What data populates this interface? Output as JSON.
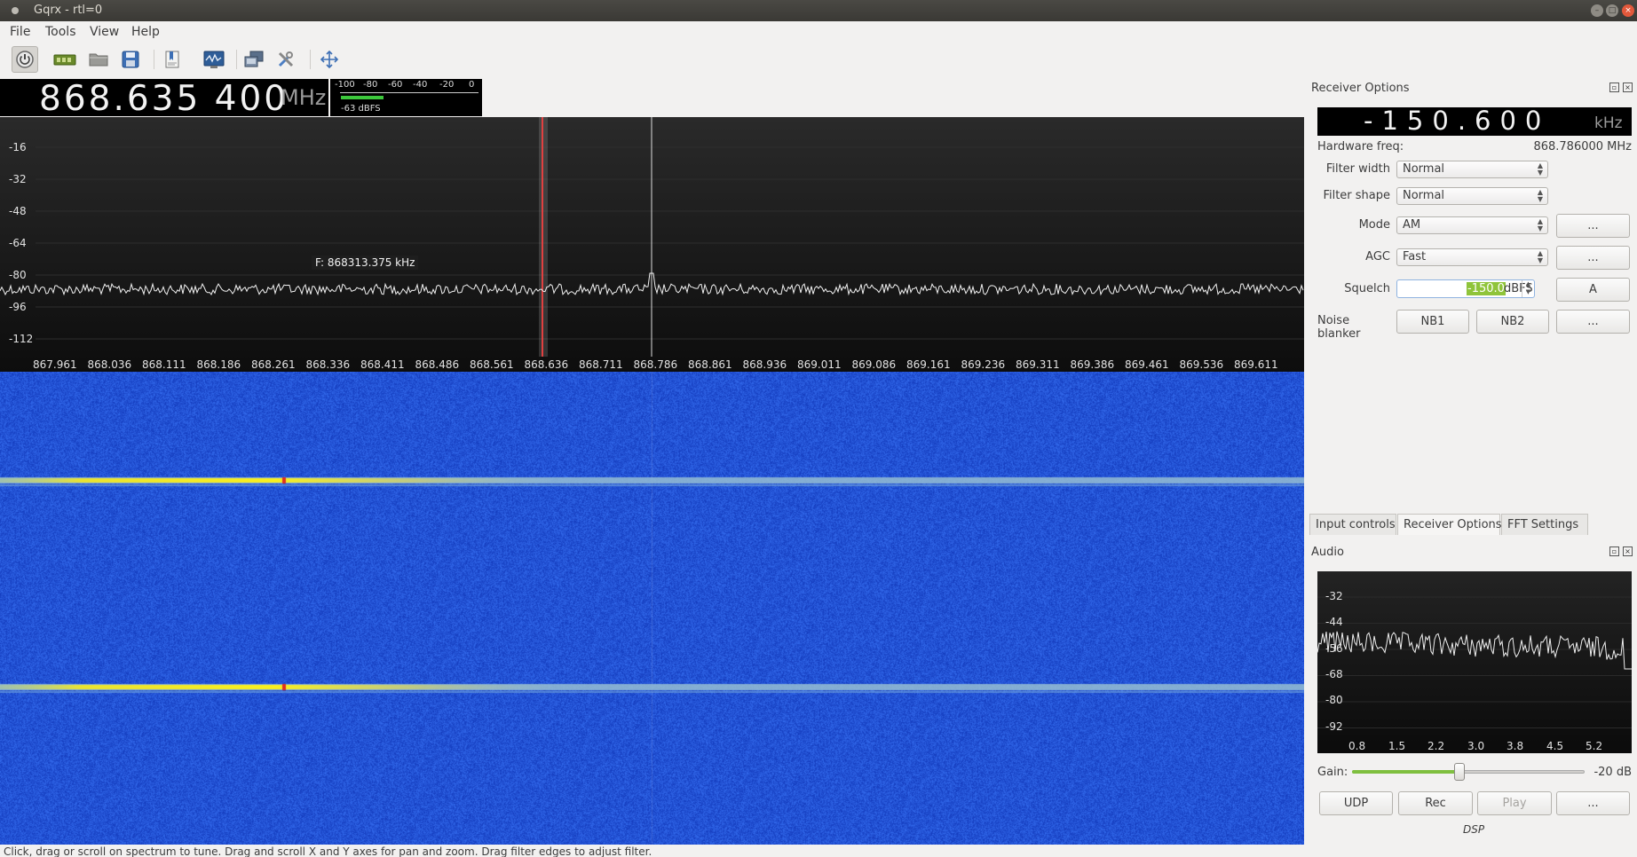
{
  "window": {
    "title": "Gqrx - rtl=0"
  },
  "menu": {
    "file": "File",
    "tools": "Tools",
    "view": "View",
    "help": "Help"
  },
  "toolbar": {
    "icons": [
      "power-icon",
      "device-icon",
      "open-folder-icon",
      "save-icon",
      "bookmark-icon",
      "waveform-icon",
      "remote-icon",
      "tools-icon",
      "fullscreen-icon"
    ]
  },
  "frequency": {
    "value": "868.635 400",
    "unit": "MHz"
  },
  "meter": {
    "ticks": [
      "-100",
      "-80",
      "-60",
      "-40",
      "-20",
      "0"
    ],
    "level_label": "-63 dBFS",
    "level_fraction": 0.31
  },
  "spectrum": {
    "y_ticks": [
      "-16",
      "-32",
      "-48",
      "-64",
      "-80",
      "-96",
      "-112"
    ],
    "x_ticks": [
      "867.961",
      "868.036",
      "868.111",
      "868.186",
      "868.261",
      "868.336",
      "868.411",
      "868.486",
      "868.561",
      "868.636",
      "868.711",
      "868.786",
      "868.861",
      "868.936",
      "869.011",
      "869.086",
      "869.161",
      "869.236",
      "869.311",
      "869.386",
      "869.461",
      "869.536",
      "869.611"
    ],
    "hover": "F: 868313.375 kHz"
  },
  "status": {
    "text": "Click, drag or scroll on spectrum to tune. Drag and scroll X and Y axes for pan and zoom. Drag filter edges to adjust filter."
  },
  "receiver": {
    "title": "Receiver Options",
    "offset": {
      "value": "-150.600",
      "unit": "kHz"
    },
    "hardware_freq_label": "Hardware freq:",
    "hardware_freq_value": "868.786000 MHz",
    "filter_width_label": "Filter width",
    "filter_width_value": "Normal",
    "filter_shape_label": "Filter shape",
    "filter_shape_value": "Normal",
    "mode_label": "Mode",
    "mode_value": "AM",
    "agc_label": "AGC",
    "agc_value": "Fast",
    "squelch_label": "Squelch",
    "squelch_value": "-150.0",
    "squelch_unit": "dBFS",
    "squelch_auto": "A",
    "noise_blanker_label": "Noise blanker",
    "nb1": "NB1",
    "nb2": "NB2",
    "more": "..."
  },
  "tabs": [
    "Input controls",
    "Receiver Options",
    "FFT Settings"
  ],
  "audio": {
    "title": "Audio",
    "y_ticks": [
      "-32",
      "-44",
      "-56",
      "-68",
      "-80",
      "-92"
    ],
    "x_ticks": [
      "0.8",
      "1.5",
      "2.2",
      "3.0",
      "3.8",
      "4.5",
      "5.2"
    ],
    "gain_label": "Gain:",
    "gain_value": "-20 dB",
    "gain_fraction": 0.46,
    "udp": "UDP",
    "rec": "Rec",
    "play": "Play",
    "more": "...",
    "dsp": "DSP"
  }
}
